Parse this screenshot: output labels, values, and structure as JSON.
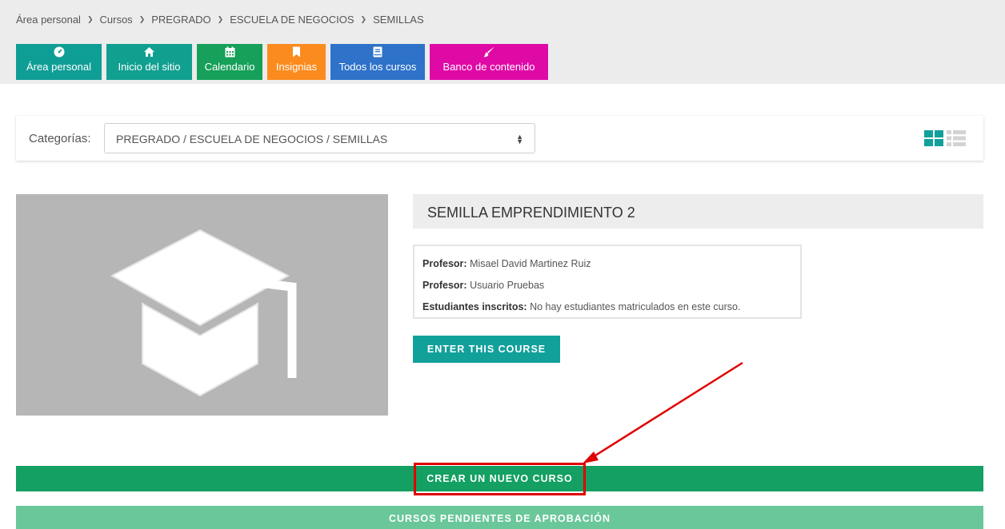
{
  "breadcrumb": [
    "Área personal",
    "Cursos",
    "PREGRADO",
    "ESCUELA DE NEGOCIOS",
    "SEMILLAS"
  ],
  "nav": [
    {
      "label": "Área personal",
      "icon": "dashboard-icon",
      "color": "#0f9e96"
    },
    {
      "label": "Inicio del sitio",
      "icon": "home-icon",
      "color": "#11a090"
    },
    {
      "label": "Calendario",
      "icon": "calendar-icon",
      "color": "#16a05a"
    },
    {
      "label": "Insignias",
      "icon": "bookmark-icon",
      "color": "#fb8b1e"
    },
    {
      "label": "Todos los cursos",
      "icon": "book-icon",
      "color": "#2e72c9"
    },
    {
      "label": "Banco de contenido",
      "icon": "brush-icon",
      "color": "#df0aa6"
    }
  ],
  "categories": {
    "label": "Categorías:",
    "selected": "PREGRADO / ESCUELA DE NEGOCIOS / SEMILLAS"
  },
  "course": {
    "title": "SEMILLA EMPRENDIMIENTO 2",
    "teacher1_label": "Profesor:",
    "teacher1": "Misael David Martinez Ruiz",
    "teacher2_label": "Profesor:",
    "teacher2": "Usuario Pruebas",
    "students_label": "Estudiantes inscritos:",
    "students": "No hay estudiantes matriculados en este curso.",
    "enter_label": "ENTER THIS COURSE"
  },
  "actions": {
    "create_label": "CREAR UN NUEVO CURSO",
    "pending_label": "CURSOS PENDIENTES DE APROBACIÓN"
  },
  "colors": {
    "teal": "#12a09b",
    "green": "#13a062",
    "light_green": "#6ac79a",
    "annotation_red": "#e00000"
  }
}
